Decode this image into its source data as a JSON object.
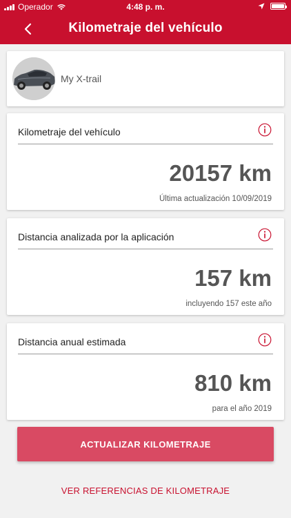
{
  "status_bar": {
    "carrier": "Operador",
    "time": "4:48 p. m."
  },
  "header": {
    "title": "Kilometraje del vehículo",
    "back_icon": "chevron-left-icon",
    "background_color": "#c8102e"
  },
  "vehicle": {
    "name": "My X-trail"
  },
  "cards": [
    {
      "label": "Kilometraje del vehículo",
      "value": "20157 km",
      "note": "Última actualización 10/09/2019",
      "icon": "info-icon"
    },
    {
      "label": "Distancia analizada por la aplicación",
      "value": "157 km",
      "note": "incluyendo 157 este año",
      "icon": "info-icon"
    },
    {
      "label": "Distancia anual estimada",
      "value": "810 km",
      "note": "para el año 2019",
      "icon": "info-icon"
    }
  ],
  "actions": {
    "update_label": "ACTUALIZAR KILOMETRAJE",
    "references_label": "VER REFERENCIAS DE KILOMETRAJE",
    "accent_color": "#d94a63"
  }
}
